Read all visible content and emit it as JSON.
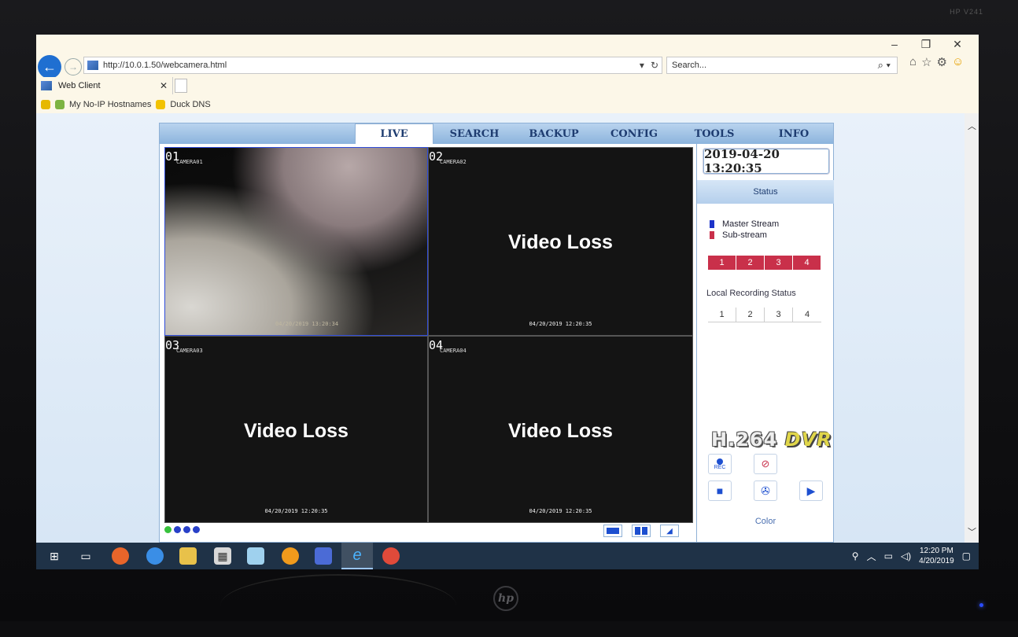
{
  "monitor": {
    "model": "HP V241",
    "brand": "hp"
  },
  "browser": {
    "window_controls": [
      "–",
      "❐",
      "✕"
    ],
    "url": "http://10.0.1.50/webcamera.html",
    "search_placeholder": "Search...",
    "tab_title": "Web Client",
    "favorites": [
      "My No-IP Hostnames",
      "Duck DNS"
    ]
  },
  "dvr": {
    "nav_tabs": [
      "LIVE",
      "SEARCH",
      "BACKUP",
      "CONFIG",
      "TOOLS",
      "INFO"
    ],
    "active_tab": "LIVE",
    "channels": [
      {
        "num": "01",
        "name": "CAMERA01",
        "timestamp": "04/20/2019 13:20:34",
        "video_loss": ""
      },
      {
        "num": "02",
        "name": "CAMERA02",
        "timestamp": "04/20/2019 12:20:35",
        "video_loss": "Video Loss"
      },
      {
        "num": "03",
        "name": "CAMERA03",
        "timestamp": "04/20/2019 12:20:35",
        "video_loss": "Video Loss"
      },
      {
        "num": "04",
        "name": "CAMERA04",
        "timestamp": "04/20/2019 12:20:35",
        "video_loss": "Video Loss"
      }
    ],
    "side": {
      "datetime": "2019-04-20 13:20:35",
      "status_header": "Status",
      "legend_master": "Master Stream",
      "legend_sub": "Sub-stream",
      "stream_channels": [
        "1",
        "2",
        "3",
        "4"
      ],
      "recording_label": "Local Recording Status",
      "recording_channels": [
        "1",
        "2",
        "3",
        "4"
      ],
      "logo_main": "H.264",
      "logo_dvr": "DVR",
      "rec_text": "REC",
      "color_label": "Color"
    },
    "colors": {
      "master": "#1d33c9",
      "sub": "#c9304a",
      "accent": "#1d4fd0"
    }
  },
  "taskbar": {
    "time": "12:20 PM",
    "date": "4/20/2019"
  }
}
